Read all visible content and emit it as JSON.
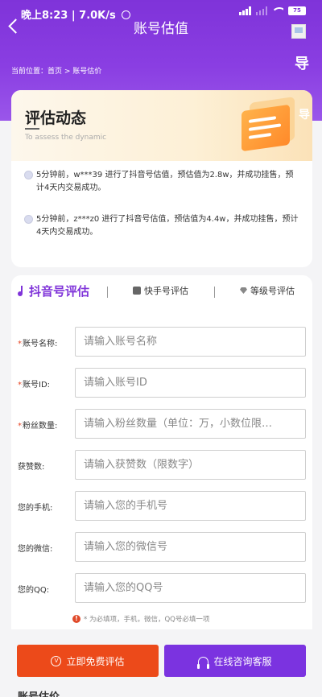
{
  "status_bar": {
    "time": "晚上8:23",
    "speed": "7.0K/s",
    "battery": "75"
  },
  "header": {
    "title": "账号估值",
    "guide_label": "导",
    "breadcrumb": "当前位置：首页 > 账号估价"
  },
  "dynamic": {
    "title": "评估动态",
    "subtitle": "To assess the dynamic",
    "items": [
      "5分钟前，w***39 进行了抖音号估值，预估值为2.8w，并成功挂售，预计4天内交易成功。",
      "5分钟前，z***z0 进行了抖音号估值，预估值为4.4w，并成功挂售，预计4天内交易成功。"
    ]
  },
  "tabs": [
    {
      "label": "抖音号评估",
      "icon": "music-note-icon",
      "active": true
    },
    {
      "label": "快手号评估",
      "icon": "kuaishou-icon",
      "active": false
    },
    {
      "label": "等级号评估",
      "icon": "gem-icon",
      "active": false
    }
  ],
  "form": {
    "fields": [
      {
        "label": "账号名称:",
        "required": true,
        "placeholder": "请输入账号名称"
      },
      {
        "label": "账号ID:",
        "required": true,
        "placeholder": "请输入账号ID"
      },
      {
        "label": "粉丝数量:",
        "required": true,
        "placeholder": "请输入粉丝数量（单位：万，小数位限…"
      },
      {
        "label": "获赞数:",
        "required": false,
        "placeholder": "请输入获赞数（限数字）"
      },
      {
        "label": "您的手机:",
        "required": false,
        "placeholder": "请输入您的手机号"
      },
      {
        "label": "您的微信:",
        "required": false,
        "placeholder": "请输入您的微信号"
      },
      {
        "label": "您的QQ:",
        "required": false,
        "placeholder": "请输入您的QQ号"
      }
    ],
    "tip": "* 为必填项，手机，微信，QQ号必填一项",
    "required_mark": "*"
  },
  "buttons": {
    "evaluate": "立即免费评估",
    "consult": "在线咨询客服"
  },
  "next_section_title": "账号估价",
  "colors": {
    "brand": "#7f33d9",
    "evaluate_button": "#ec4a1a",
    "consult_button": "#7b33e0"
  }
}
